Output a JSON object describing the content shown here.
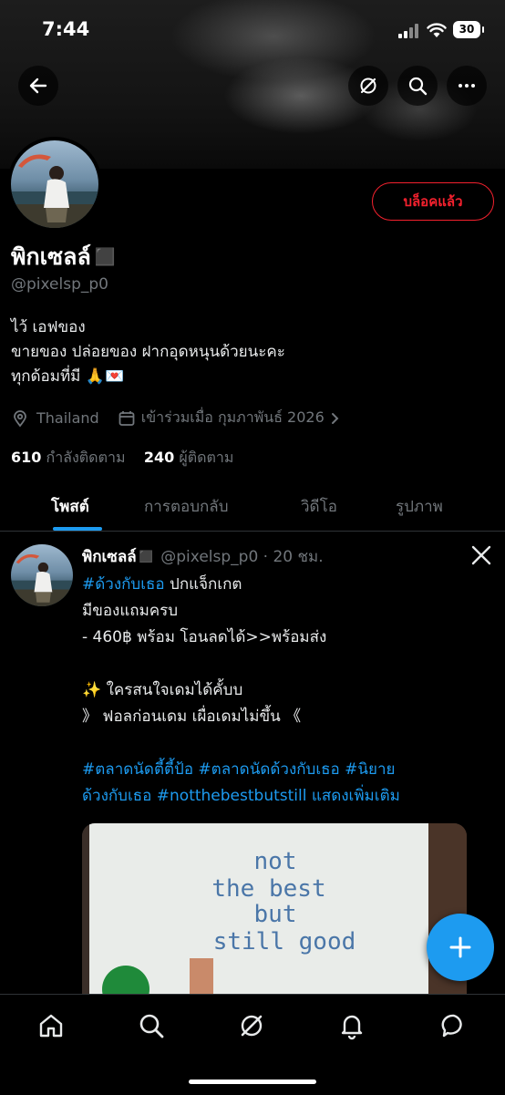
{
  "status_bar": {
    "time": "7:44",
    "battery": "30"
  },
  "profile": {
    "name": "พิกเซลล์◼️",
    "handle": "@pixelsp_p0",
    "blocked_label": "บล็อคแล้ว",
    "bio_lines": [
      "ไว้ เอฟของ",
      "ขายของ ปล่อยของ ฝากอุดหนุนด้วยนะคะ",
      "ทุกด้อมที่มี 🙏💌"
    ],
    "location": "Thailand",
    "joined": "เข้าร่วมเมื่อ กุมภาพันธ์ 2026",
    "following_count": "610",
    "following_label": "กำลังติดตาม",
    "followers_count": "240",
    "followers_label": "ผู้ติดตาม"
  },
  "tabs": [
    {
      "label": "โพสต์"
    },
    {
      "label": "การตอบกลับ"
    },
    {
      "label": "วิดีโอ"
    },
    {
      "label": "รูปภาพ"
    }
  ],
  "post": {
    "author": "พิกเซลล์◼️",
    "handle_time": "@pixelsp_p0 · 20 ชม.",
    "hashtag_1": "#ด้วงกับเธอ",
    "line1_rest": " ปกแจ็กเกต",
    "line2": "มีของแถมครบ",
    "line3": "- 460฿  พร้อม โอนลดได้>>พร้อมส่ง",
    "line4": "✨ ใครสนใจเดมได้คั้บบ",
    "line5": "》 ฟอลก่อนเดม เผื่อเดมไม่ขึ้น 《",
    "tags_line1": "#ตลาดนัดตี้ตี้ป้อ #ตลาดนัดด้วงกับเธอ #นิยาย",
    "tags_line2": "ด้วงกับเธอ #notthebestbutstill",
    "show_more": "แสดงเพิ่มเติม",
    "image_text": [
      "not",
      "the best",
      "but",
      "still good"
    ]
  },
  "colors": {
    "accent": "#1d9bf0",
    "blocked": "#f4212e",
    "muted": "#71767b"
  }
}
